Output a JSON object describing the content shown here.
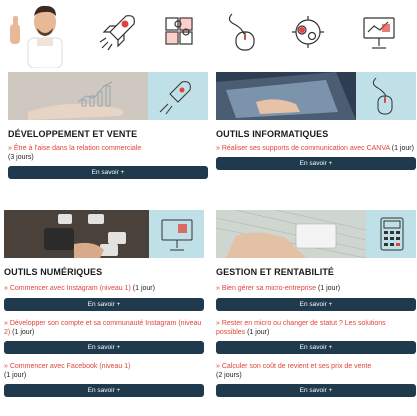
{
  "hero": {
    "icons": [
      "person-thumb-icon",
      "rocket-icon",
      "puzzle-icon",
      "mouse-icon",
      "gears-icon",
      "presentation-icon"
    ]
  },
  "categories": [
    {
      "title": "DÉVELOPPEMENT ET VENTE",
      "courses": [
        {
          "link": "» Être à l'aise dans la relation commerciale",
          "duration": "(3 jours)",
          "button": "En savoir +"
        }
      ]
    },
    {
      "title": "OUTILS INFORMATIQUES",
      "courses": [
        {
          "link": "» Réaliser ses supports de communication avec CANVA",
          "duration": " (1 jour)",
          "button": "En savoir +"
        }
      ]
    },
    {
      "title": "OUTILS NUMÉRIQUES",
      "courses": [
        {
          "link": "» Commencer avec Instagram (niveau 1)",
          "duration": " (1 jour)",
          "button": "En savoir +"
        },
        {
          "link": "» Développer son compte et sa communauté Instagram (niveau 2)",
          "duration": " (1 jour)",
          "button": "En savoir +"
        },
        {
          "link": "» Commencer avec Facebook (niveau 1)",
          "duration": "(1 jour)",
          "button": "En savoir +"
        }
      ]
    },
    {
      "title": "GESTION ET RENTABILITÉ",
      "courses": [
        {
          "link": "» Bien gérer sa micro-entreprise",
          "duration": " (1 jour)",
          "button": "En savoir +"
        },
        {
          "link": "» Rester en micro ou changer de statut ? Les solutions possibles",
          "duration": " (1 jour)",
          "button": "En savoir +"
        },
        {
          "link": "» Calculer son coût de revient et ses prix de vente",
          "duration": "(2 jours)",
          "button": "En savoir +"
        }
      ]
    }
  ],
  "colors": {
    "accent": "#e2443a",
    "button": "#1e3a4c",
    "banner_bg": "#bfe0e6"
  }
}
